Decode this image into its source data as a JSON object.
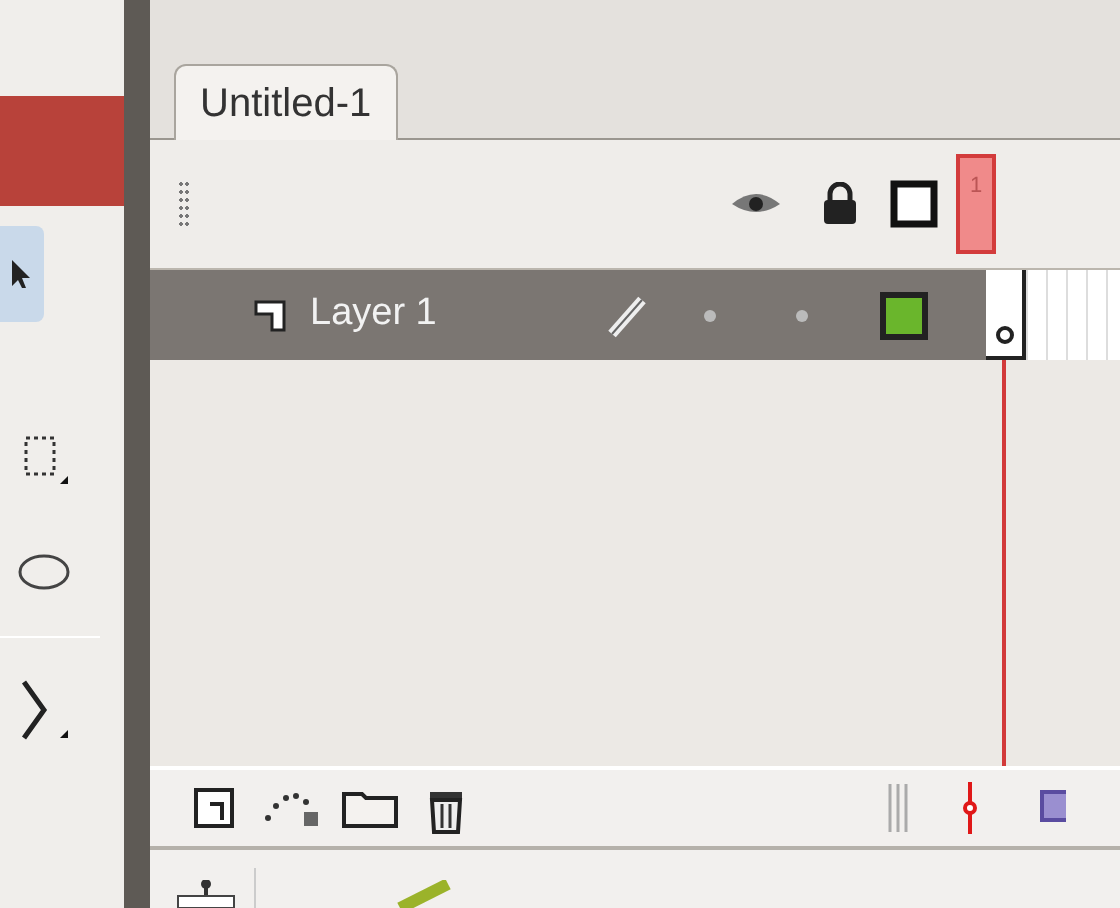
{
  "document_tabs": [
    {
      "label": "Untitled-1",
      "selected": true
    }
  ],
  "timeline": {
    "current_frame": "1",
    "layers": [
      {
        "name": "Layer 1",
        "selected": true,
        "color": "#6ab62c"
      }
    ]
  }
}
